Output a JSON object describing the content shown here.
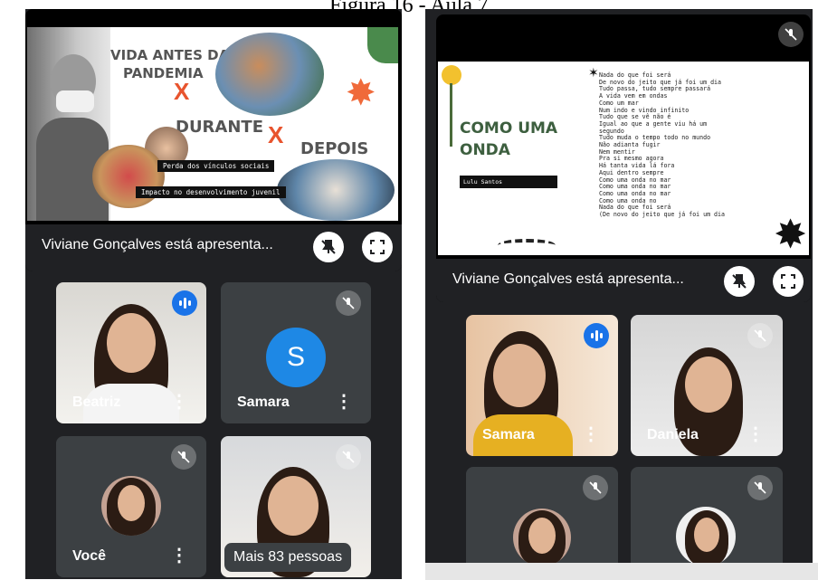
{
  "caption": "Figura 16 - Aula 7",
  "left": {
    "slide": {
      "title_line1": "VIDA ANTES DA",
      "title_line2": "PANDEMIA",
      "cross": "X",
      "title_during": "DURANTE",
      "title_after": "DEPOIS",
      "label1": "Perda dos vínculos sociais",
      "label2": "Impacto no desenvolvimento juvenil"
    },
    "presenter_text": "Viviane Gonçalves está apresenta...",
    "tiles": [
      {
        "name": "Beatriz",
        "speaking": true
      },
      {
        "name": "Samara",
        "initial": "S",
        "muted": true
      },
      {
        "name": "Você",
        "muted": true
      },
      {
        "name": "Mais 83 pessoas",
        "muted": true
      }
    ]
  },
  "right": {
    "slide": {
      "title_line1": "COMO UMA",
      "title_line2": "ONDA",
      "author": "Lulu Santos",
      "poem": "Nada do que foi será\nDe novo do jeito que já foi um dia\nTudo passa, tudo sempre passará\nA vida vem em ondas\nComo um mar\nNum indo e vindo infinito\nTudo que se vê não é\nIgual ao que a gente viu há um\nsegundo\nTudo muda o tempo todo no mundo\nNão adianta fugir\nNem mentir\nPra si mesmo agora\nHá tanta vida lá fora\nAqui dentro sempre\nComo uma onda no mar\nComo uma onda no mar\nComo uma onda no mar\nComo uma onda no\nNada do que foi será\n(De novo do jeito que já foi um dia"
    },
    "presenter_text": "Viviane Gonçalves está apresenta...",
    "tiles": [
      {
        "name": "Samara",
        "speaking": true
      },
      {
        "name": "Daniela",
        "muted": true
      },
      {
        "name": "",
        "muted": true
      },
      {
        "name": "",
        "muted": true
      }
    ]
  },
  "colors": {
    "speaking": "#1a73e8",
    "avatar_s": "#1e88e5",
    "panel": "#202124",
    "tile": "#3c4043"
  }
}
